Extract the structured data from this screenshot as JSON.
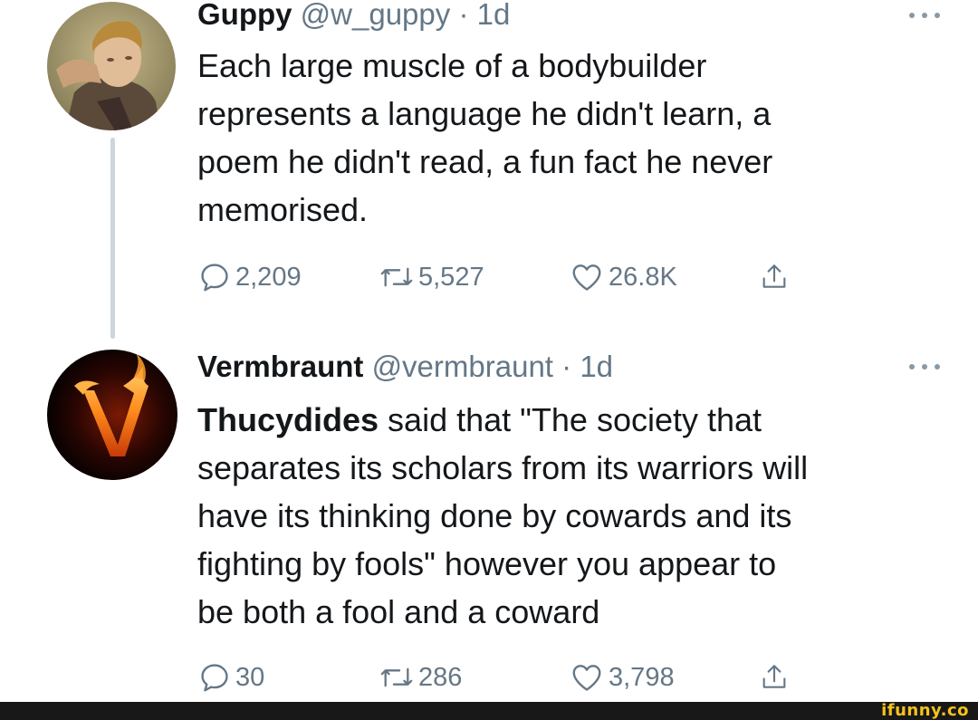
{
  "tweets": [
    {
      "name": "Guppy",
      "handle": "@w_guppy",
      "separator": "·",
      "time": "1d",
      "text": "Each large muscle of a bodybuilder\nrepresents a language he didn't learn, a\npoem he didn't read, a fun fact he never\nmemorised.",
      "replies": "2,209",
      "retweets": "5,527",
      "likes": "26.8K",
      "avatar_icon": "portrait-avatar"
    },
    {
      "name": "Vermbraunt",
      "handle": "@vermbraunt",
      "separator": "·",
      "time": "1d",
      "text_bold": "Thucydides",
      "text_rest": " said that \"The society that\nseparates its scholars from its warriors will\nhave its thinking done by cowards and its\nfighting by fools\" however you appear to\nbe both a fool and a coward",
      "replies": "30",
      "retweets": "286",
      "likes": "3,798",
      "avatar_icon": "flaming-v-avatar"
    }
  ],
  "icons": {
    "reply": "reply-icon",
    "retweet": "retweet-icon",
    "like": "heart-icon",
    "share": "share-icon",
    "more": "more-icon"
  },
  "colors": {
    "text": "#14171a",
    "secondary": "#657786",
    "thread_line": "#ccd6dd",
    "watermark": "#f6c21c"
  },
  "watermark": "ifunny.co"
}
